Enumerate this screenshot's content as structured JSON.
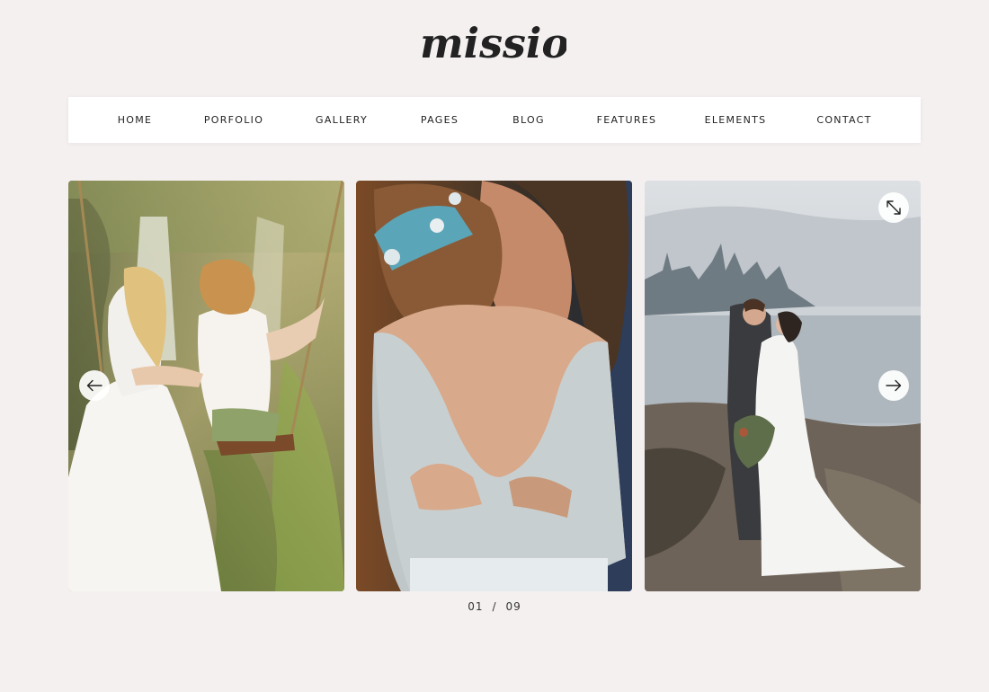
{
  "brand": {
    "logo_text": "missio"
  },
  "nav": {
    "items": [
      {
        "label": "HOME"
      },
      {
        "label": "PORFOLIO"
      },
      {
        "label": "GALLERY"
      },
      {
        "label": "PAGES"
      },
      {
        "label": "BLOG"
      },
      {
        "label": "FEATURES"
      },
      {
        "label": "ELEMENTS"
      },
      {
        "label": "CONTACT"
      }
    ]
  },
  "slider": {
    "current": "01",
    "separator": "/",
    "total": "09",
    "icons": {
      "prev": "arrow-left-icon",
      "next": "arrow-right-icon",
      "fullscreen": "expand-icon"
    },
    "slides": [
      {
        "alt": "Two women on a rope swing by a waterfall"
      },
      {
        "alt": "Bride in a lace backless dress embracing groom"
      },
      {
        "alt": "Bride and groom kissing on a misty lakeshore"
      }
    ]
  },
  "colors": {
    "page_background": "#f4f0f0",
    "nav_background": "#ffffff",
    "text": "#1d1d1d"
  }
}
